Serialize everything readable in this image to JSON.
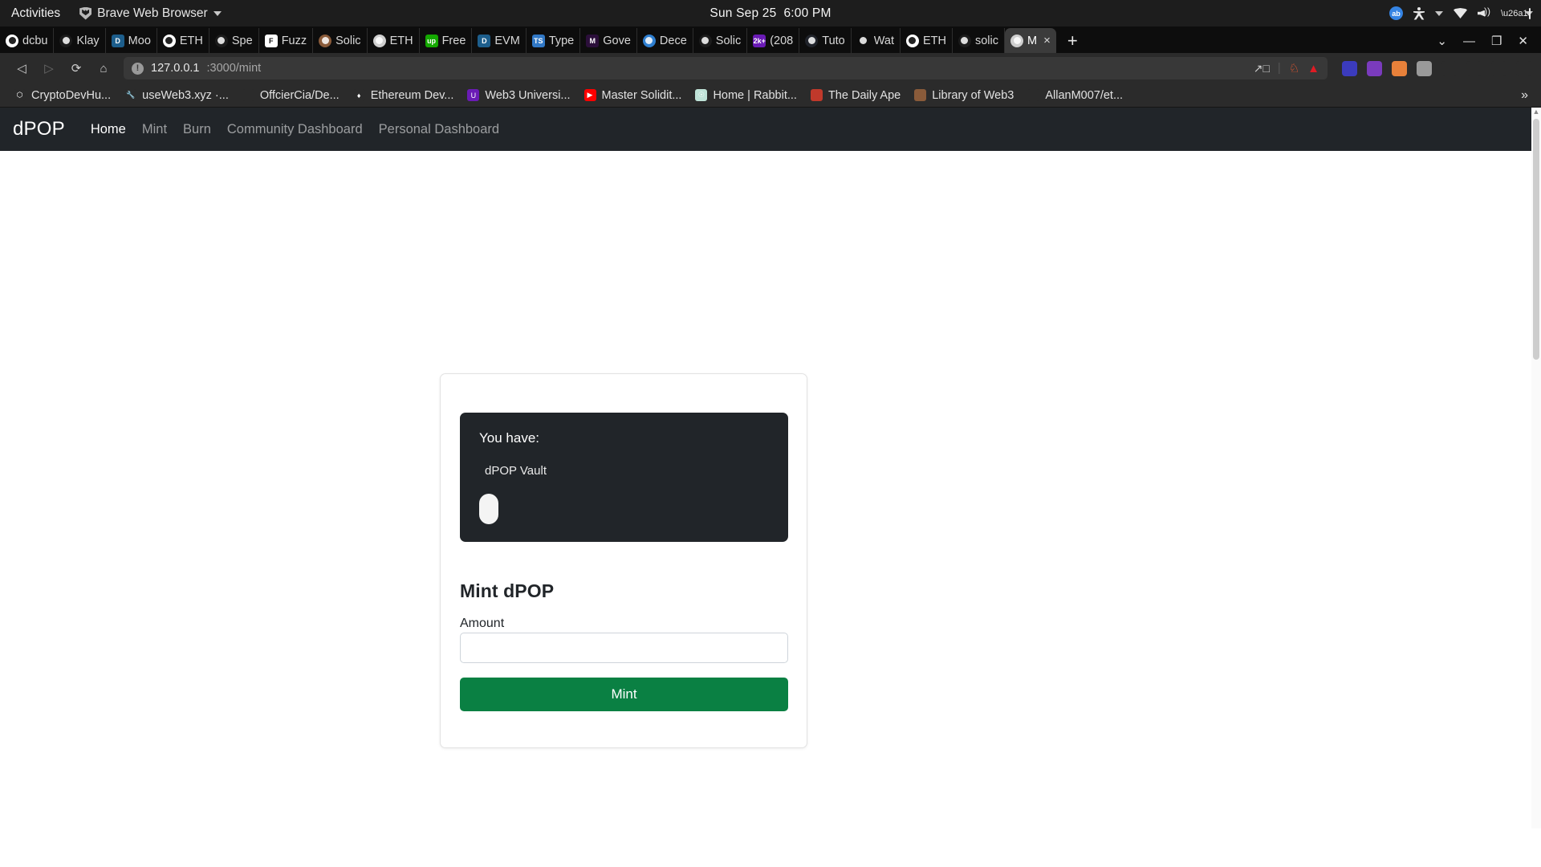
{
  "desktop": {
    "activities": "Activities",
    "app_name": "Brave Web Browser",
    "clock_date": "Sun Sep 25",
    "clock_time": "6:00 PM",
    "indicators": [
      "blue-badge-icon",
      "accessibility-icon",
      "chevron-down-icon",
      "wifi-icon",
      "volume-icon",
      "battery-charging-icon",
      "chevron-down-icon"
    ]
  },
  "browser": {
    "tabs": [
      {
        "label": "dcbu",
        "icon": "github-icon",
        "color": "#ffffff",
        "glyph": "",
        "active": false
      },
      {
        "label": "Klay",
        "icon": "klaytn-icon",
        "color": "#1b1b1b",
        "glyph": "",
        "active": false
      },
      {
        "label": "Moo",
        "icon": "moonbeam-icon",
        "color": "#1d5e8c",
        "glyph": "D",
        "active": false
      },
      {
        "label": "ETH",
        "icon": "ethereum-icon",
        "color": "#ffffff",
        "glyph": "",
        "active": false
      },
      {
        "label": "Spe",
        "icon": "speedrun-icon",
        "color": "#1c1c1c",
        "glyph": "",
        "active": false
      },
      {
        "label": "Fuzz",
        "icon": "foundry-icon",
        "color": "#ffffff",
        "glyph": "F",
        "active": false
      },
      {
        "label": "Solic",
        "icon": "avatar-icon",
        "color": "#8a5b3a",
        "glyph": "",
        "active": false
      },
      {
        "label": "ETH",
        "icon": "globe-icon",
        "color": "#cfcfcf",
        "glyph": "",
        "active": false
      },
      {
        "label": "Free",
        "icon": "upwork-icon",
        "color": "#14a800",
        "glyph": "up",
        "active": false
      },
      {
        "label": "EVM",
        "icon": "moonbeam-icon",
        "color": "#1d5e8c",
        "glyph": "D",
        "active": false
      },
      {
        "label": "Type",
        "icon": "typescript-icon",
        "color": "#3178c6",
        "glyph": "TS",
        "active": false
      },
      {
        "label": "Gove",
        "icon": "medium-icon",
        "color": "#2b0f3a",
        "glyph": "M",
        "active": false
      },
      {
        "label": "Dece",
        "icon": "earth-icon",
        "color": "#2f7fd0",
        "glyph": "",
        "active": false
      },
      {
        "label": "Solic",
        "icon": "blank-icon",
        "color": "#1c1c1c",
        "glyph": "",
        "active": false
      },
      {
        "label": "(208",
        "icon": "youtube-2k-icon",
        "color": "#6a1bb5",
        "glyph": "2k+",
        "active": false
      },
      {
        "label": "Tuto",
        "icon": "react-icon",
        "color": "#20232a",
        "glyph": "",
        "active": false
      },
      {
        "label": "Wat",
        "icon": "play-icon",
        "color": "#0d0d0d",
        "glyph": "",
        "active": false
      },
      {
        "label": "ETH",
        "icon": "rainbow-icon",
        "color": "#ffffff",
        "glyph": "",
        "active": false
      },
      {
        "label": "solic",
        "icon": "solidity-icon",
        "color": "#1c1c1c",
        "glyph": "",
        "active": false
      },
      {
        "label": "M",
        "icon": "globe-icon",
        "color": "#cfcfcf",
        "glyph": "",
        "active": true
      }
    ],
    "tab_close_label": "×",
    "new_tab_label": "+",
    "tabstrip_right": [
      "tab-search-chevron-icon",
      "minimize-icon",
      "maximize-icon",
      "close-icon"
    ],
    "window_controls": {
      "chevron": "⌄",
      "minimize": "—",
      "maximize": "❐",
      "close": "✕"
    },
    "nav": {
      "back": "back-icon",
      "forward": "forward-icon",
      "reload": "reload-icon",
      "home": "home-icon",
      "bookmark": "bookmark-icon"
    },
    "url": {
      "host": "127.0.0.1",
      "path": ":3000/mint",
      "security_icon": "info-circle-icon",
      "open_in_new_icon": "open-external-icon",
      "brave_shields_icon": "brave-lion-icon",
      "brave_rewards_icon": "brave-triangle-icon"
    },
    "extensions": [
      {
        "name": "metamask-wallet-icon",
        "color": "#3b3bbd",
        "glyph": ""
      },
      {
        "name": "ghost-extension-icon",
        "color": "#7a3bbd",
        "glyph": ""
      },
      {
        "name": "rabby-wallet-icon",
        "color": "#e8813a",
        "glyph": ""
      },
      {
        "name": "grey-extension-icon",
        "color": "#9a9a9a",
        "glyph": ""
      },
      {
        "name": "puzzle-extensions-icon",
        "color": "#2b2b2b",
        "glyph": ""
      },
      {
        "name": "playlist-icon",
        "color": "#2b2b2b",
        "glyph": ""
      },
      {
        "name": "sidebar-icon",
        "color": "#2b2b2b",
        "glyph": ""
      },
      {
        "name": "hamburger-menu-icon",
        "color": "#2b2b2b",
        "glyph": ""
      }
    ],
    "bookmarks": [
      {
        "label": "CryptoDevHu...",
        "icon": "hexagon-icon",
        "color": "#2b2b2b",
        "glyph": "⬡"
      },
      {
        "label": "useWeb3.xyz ·...",
        "icon": "tools-icon",
        "color": "#2b2b2b",
        "glyph": "🔧"
      },
      {
        "label": "OffcierCia/De...",
        "icon": "github-icon",
        "color": "#2b2b2b",
        "glyph": ""
      },
      {
        "label": "Ethereum Dev...",
        "icon": "ethereum-icon",
        "color": "#2b2b2b",
        "glyph": "♦"
      },
      {
        "label": "Web3 Universi...",
        "icon": "web3university-icon",
        "color": "#6a1bb5",
        "glyph": "U"
      },
      {
        "label": "Master Solidit...",
        "icon": "youtube-icon",
        "color": "#ff0000",
        "glyph": "▶"
      },
      {
        "label": "Home | Rabbit...",
        "icon": "rabbithole-icon",
        "color": "#bfe3d8",
        "glyph": "☉"
      },
      {
        "label": "The Daily Ape",
        "icon": "ape-icon",
        "color": "#c0392b",
        "glyph": ""
      },
      {
        "label": "Library of Web3",
        "icon": "avatar-icon",
        "color": "#8a5b3a",
        "glyph": ""
      },
      {
        "label": "AllanM007/et...",
        "icon": "github-icon",
        "color": "#2b2b2b",
        "glyph": ""
      }
    ],
    "bookmarks_overflow": "»"
  },
  "app": {
    "brand": "dPOP",
    "nav_links": [
      {
        "label": "Home",
        "active": true
      },
      {
        "label": "Mint",
        "active": false
      },
      {
        "label": "Burn",
        "active": false
      },
      {
        "label": "Community Dashboard",
        "active": false
      },
      {
        "label": "Personal Dashboard",
        "active": false
      }
    ],
    "vault": {
      "heading": "You have:",
      "item_label": "dPOP Vault",
      "indicator": "loading-pill-indicator",
      "background_color": "#212529"
    },
    "mint": {
      "title": "Mint dPOP",
      "amount_label": "Amount",
      "amount_value": "",
      "amount_placeholder": "",
      "button_label": "Mint",
      "button_color": "#0a8043"
    }
  }
}
